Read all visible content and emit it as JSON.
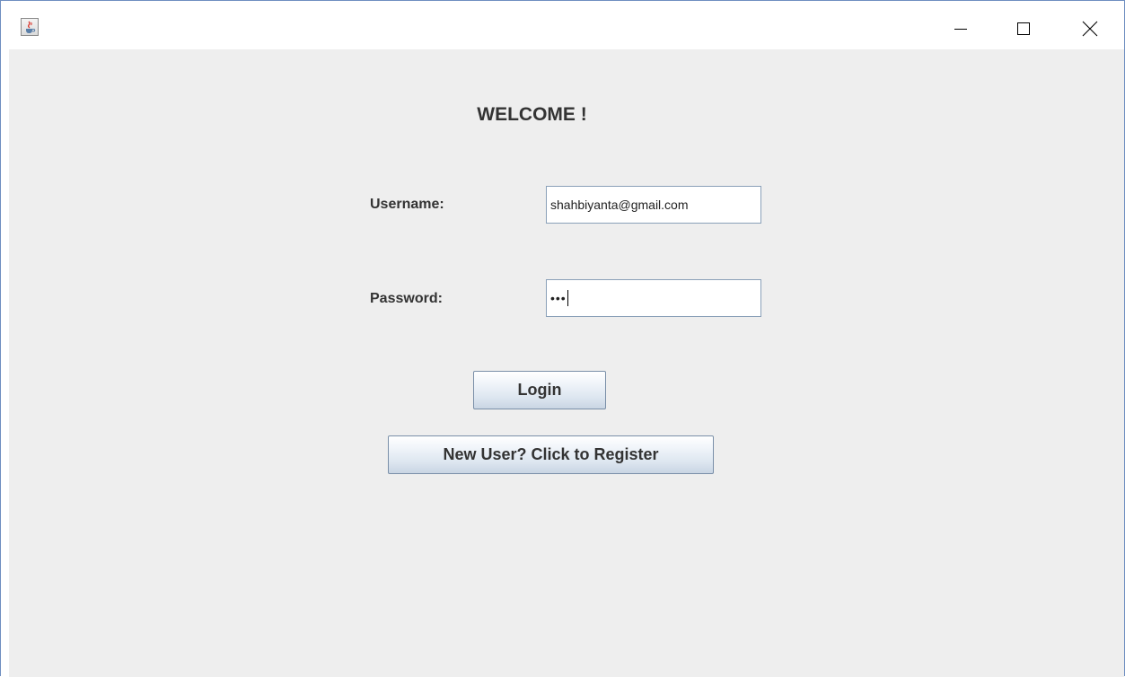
{
  "window": {
    "controls": {
      "minimize": "minimize-icon",
      "maximize": "maximize-icon",
      "close": "close-icon"
    },
    "app_icon": "java-cup-icon"
  },
  "form": {
    "heading": "WELCOME !",
    "username_label": "Username:",
    "username_value": "shahbiyanta@gmail.com",
    "password_label": "Password:",
    "password_value": "•••",
    "login_button": "Login",
    "register_button": "New User? Click to Register"
  },
  "colors": {
    "window_background": "#eeeeee",
    "button_border": "#7a8fa8",
    "field_border": "#8aa0b8"
  }
}
